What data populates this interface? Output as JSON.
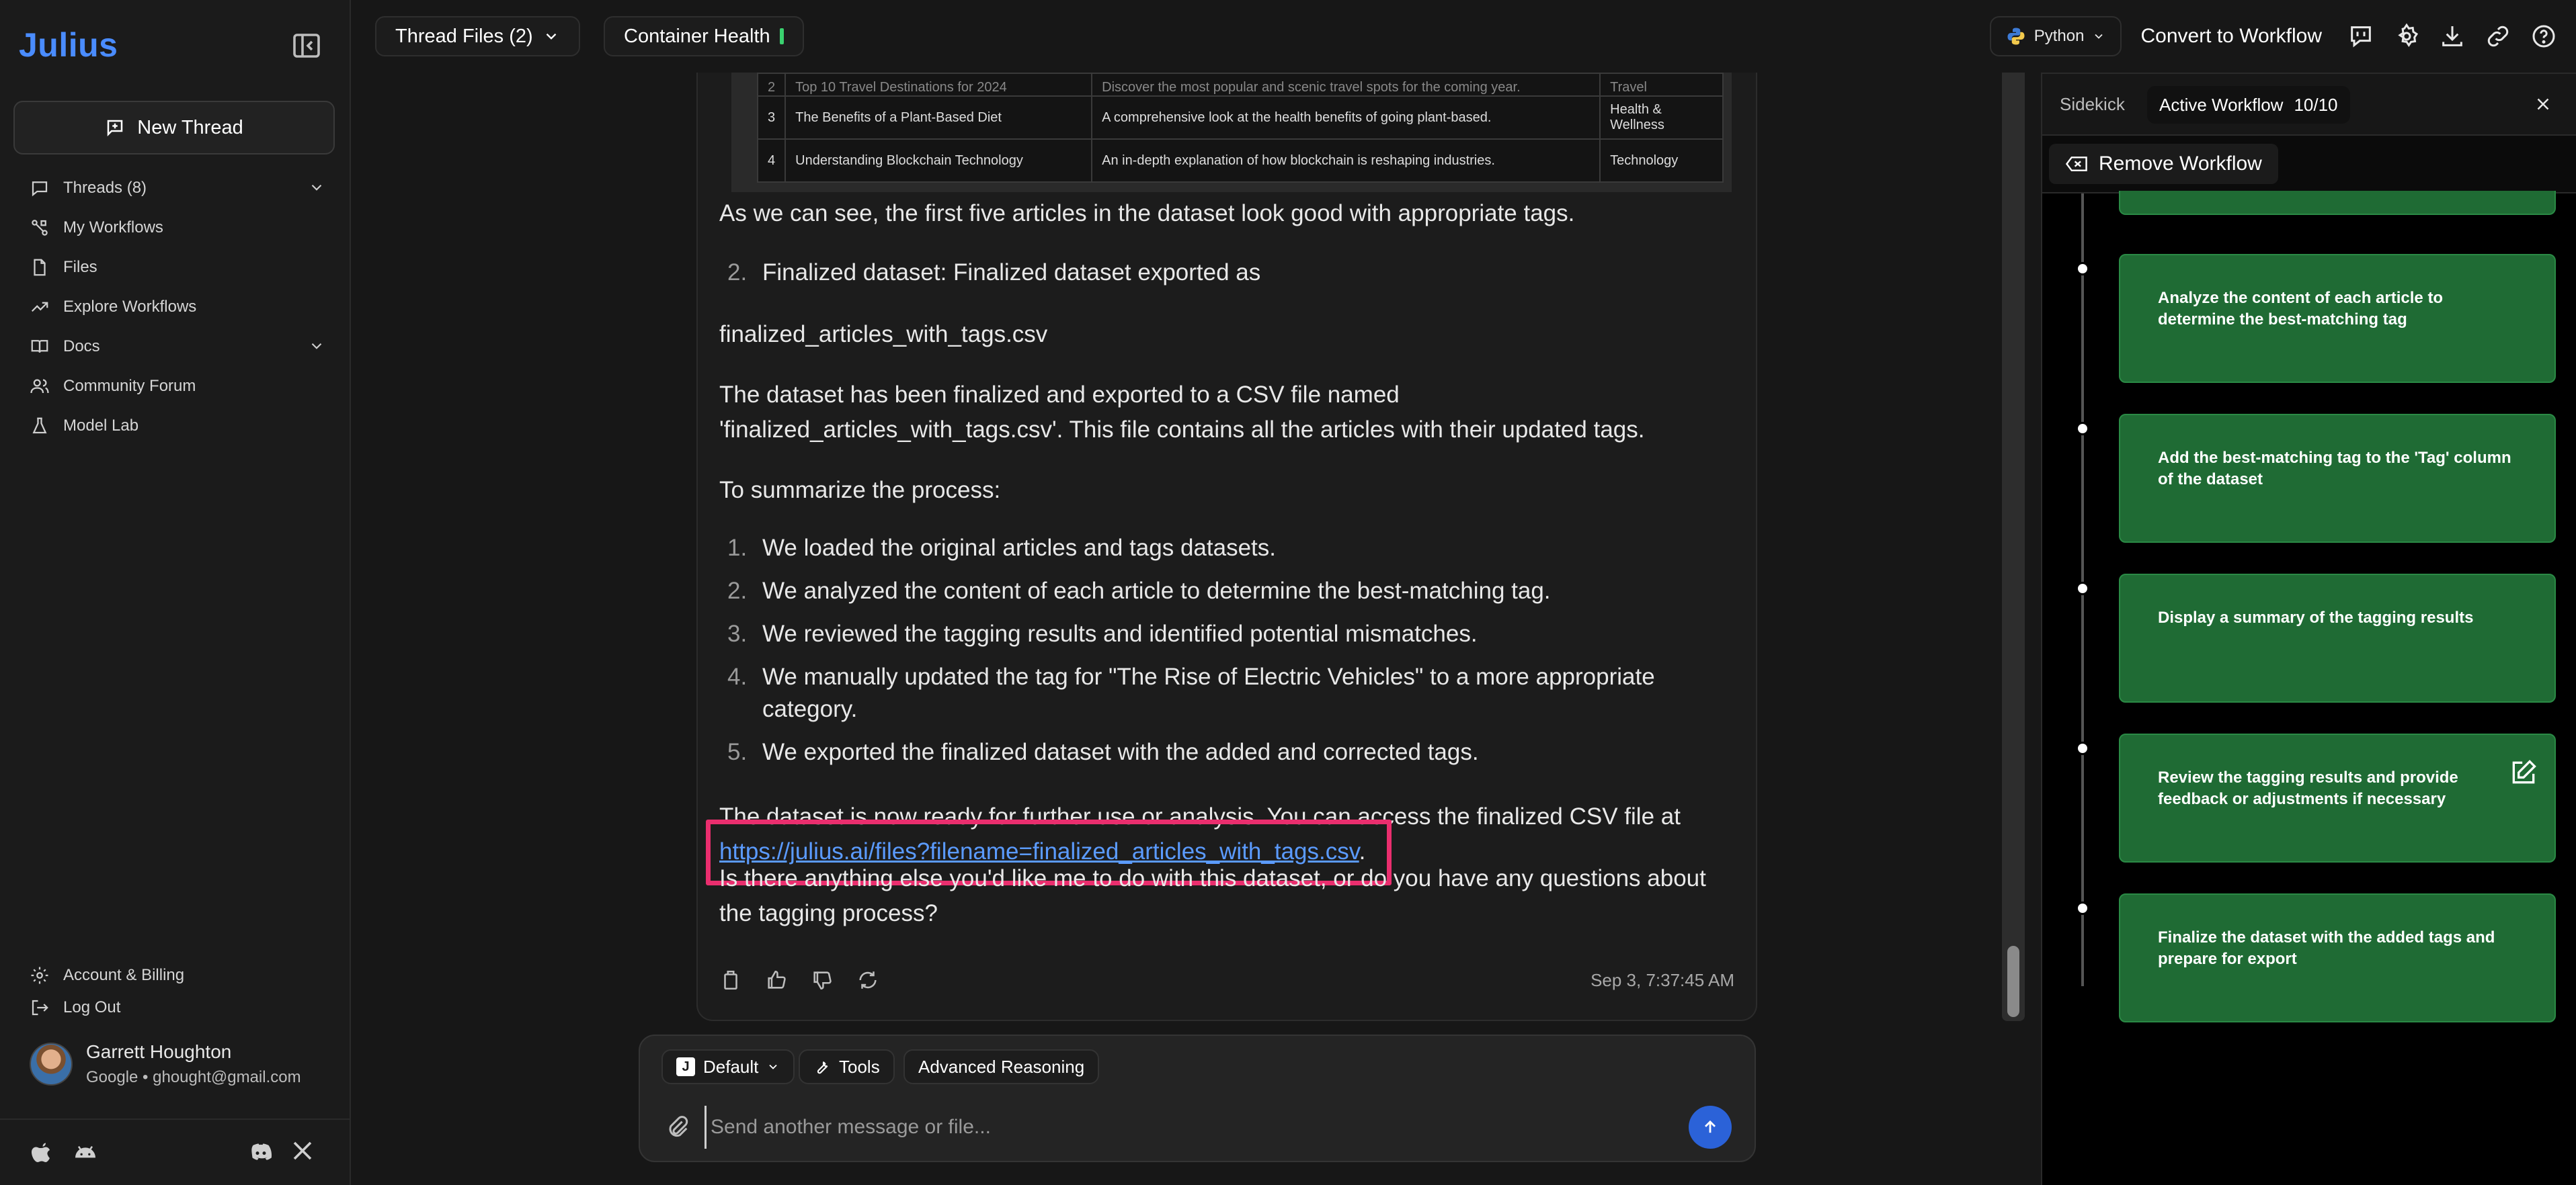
{
  "sidebar": {
    "logo": "Julius",
    "new_thread": "New Thread",
    "nav": [
      {
        "label": "Threads (8)",
        "icon": "chat-bubble-icon"
      },
      {
        "label": "My Workflows",
        "icon": "workflow-icon"
      },
      {
        "label": "Files",
        "icon": "file-icon"
      },
      {
        "label": "Explore Workflows",
        "icon": "trending-icon"
      },
      {
        "label": "Docs",
        "icon": "book-icon"
      },
      {
        "label": "Community Forum",
        "icon": "users-icon"
      },
      {
        "label": "Model Lab",
        "icon": "flask-icon"
      }
    ],
    "account": "Account & Billing",
    "logout": "Log Out",
    "user_name": "Garrett Houghton",
    "user_email": "Google • ghought@gmail.com"
  },
  "topbar": {
    "thread_files": "Thread Files (2)",
    "container_health": "Container Health",
    "language": "Python",
    "convert": "Convert to Workflow"
  },
  "chat": {
    "table_rows": [
      {
        "n": "2",
        "title": "Top 10 Travel Destinations for 2024",
        "desc": "Discover the most popular and scenic travel spots for the coming year.",
        "tag": "Travel"
      },
      {
        "n": "3",
        "title": "The Benefits of a Plant-Based Diet",
        "desc": "A comprehensive look at the health benefits of going plant-based.",
        "tag": "Health & Wellness"
      },
      {
        "n": "4",
        "title": "Understanding Blockchain Technology",
        "desc": "An in-depth explanation of how blockchain is reshaping industries.",
        "tag": "Technology"
      }
    ],
    "p1": "As we can see, the first five articles in the dataset look good with appropriate tags.",
    "item2_num": "2.",
    "item2": "Finalized dataset: Finalized dataset exported as",
    "filename": "finalized_articles_with_tags.csv",
    "p2": "The dataset has been finalized and exported to a CSV file named 'finalized_articles_with_tags.csv'. This file contains all the articles with their updated tags.",
    "p3": "To summarize the process:",
    "steps": [
      {
        "n": "1.",
        "text": "We loaded the original articles and tags datasets."
      },
      {
        "n": "2.",
        "text": "We analyzed the content of each article to determine the best-matching tag."
      },
      {
        "n": "3.",
        "text": "We reviewed the tagging results and identified potential mismatches."
      },
      {
        "n": "4.",
        "text": "We manually updated the tag for \"The Rise of Electric Vehicles\" to a more appropriate category."
      },
      {
        "n": "5.",
        "text": "We exported the finalized dataset with the added and corrected tags."
      }
    ],
    "p4": "The dataset is now ready for further use or analysis. You can access the finalized CSV file at",
    "link": "https://julius.ai/files?filename=finalized_articles_with_tags.csv",
    "link_suffix": ".",
    "p5": "Is there anything else you'd like me to do with this dataset, or do you have any questions about the tagging process?",
    "timestamp": "Sep 3, 7:37:45 AM"
  },
  "composer": {
    "model": "Default",
    "tools": "Tools",
    "reasoning": "Advanced Reasoning",
    "placeholder": "Send another message or file..."
  },
  "workflow": {
    "tab_sidekick": "Sidekick",
    "tab_active": "Active Workflow",
    "progress": "10/10",
    "remove": "Remove Workflow",
    "steps": [
      "Analyze the content of each article to determine the best-matching tag",
      "Add the best-matching tag to the 'Tag' column of the dataset",
      "Display a summary of the tagging results",
      "Review the tagging results and provide feedback or adjustments if necessary",
      "Finalize the dataset with the added tags and prepare for export"
    ]
  },
  "colors": {
    "accent": "#4a8cff",
    "step_green": "#1f6b34",
    "highlight": "#ea2e6e",
    "health_ok": "#3ad16f"
  }
}
